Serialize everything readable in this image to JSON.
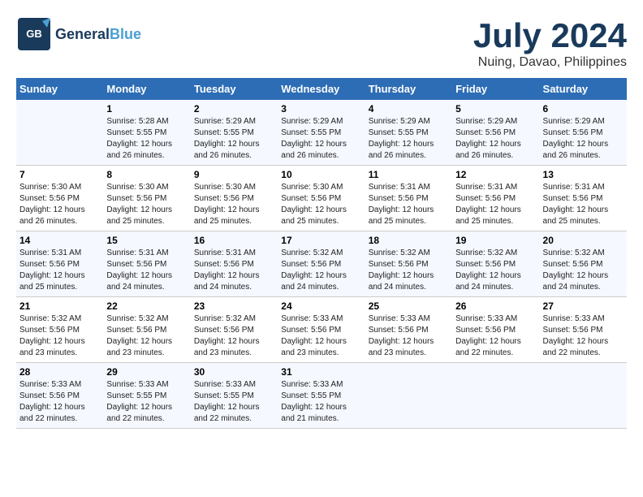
{
  "logo": {
    "text_general": "General",
    "text_blue": "Blue",
    "bird_symbol": "🐦"
  },
  "title": "July 2024",
  "subtitle": "Nuing, Davao, Philippines",
  "days_header": [
    "Sunday",
    "Monday",
    "Tuesday",
    "Wednesday",
    "Thursday",
    "Friday",
    "Saturday"
  ],
  "weeks": [
    [
      {
        "date": "",
        "info": ""
      },
      {
        "date": "1",
        "info": "Sunrise: 5:28 AM\nSunset: 5:55 PM\nDaylight: 12 hours\nand 26 minutes."
      },
      {
        "date": "2",
        "info": "Sunrise: 5:29 AM\nSunset: 5:55 PM\nDaylight: 12 hours\nand 26 minutes."
      },
      {
        "date": "3",
        "info": "Sunrise: 5:29 AM\nSunset: 5:55 PM\nDaylight: 12 hours\nand 26 minutes."
      },
      {
        "date": "4",
        "info": "Sunrise: 5:29 AM\nSunset: 5:55 PM\nDaylight: 12 hours\nand 26 minutes."
      },
      {
        "date": "5",
        "info": "Sunrise: 5:29 AM\nSunset: 5:56 PM\nDaylight: 12 hours\nand 26 minutes."
      },
      {
        "date": "6",
        "info": "Sunrise: 5:29 AM\nSunset: 5:56 PM\nDaylight: 12 hours\nand 26 minutes."
      }
    ],
    [
      {
        "date": "7",
        "info": "Sunrise: 5:30 AM\nSunset: 5:56 PM\nDaylight: 12 hours\nand 26 minutes."
      },
      {
        "date": "8",
        "info": "Sunrise: 5:30 AM\nSunset: 5:56 PM\nDaylight: 12 hours\nand 25 minutes."
      },
      {
        "date": "9",
        "info": "Sunrise: 5:30 AM\nSunset: 5:56 PM\nDaylight: 12 hours\nand 25 minutes."
      },
      {
        "date": "10",
        "info": "Sunrise: 5:30 AM\nSunset: 5:56 PM\nDaylight: 12 hours\nand 25 minutes."
      },
      {
        "date": "11",
        "info": "Sunrise: 5:31 AM\nSunset: 5:56 PM\nDaylight: 12 hours\nand 25 minutes."
      },
      {
        "date": "12",
        "info": "Sunrise: 5:31 AM\nSunset: 5:56 PM\nDaylight: 12 hours\nand 25 minutes."
      },
      {
        "date": "13",
        "info": "Sunrise: 5:31 AM\nSunset: 5:56 PM\nDaylight: 12 hours\nand 25 minutes."
      }
    ],
    [
      {
        "date": "14",
        "info": "Sunrise: 5:31 AM\nSunset: 5:56 PM\nDaylight: 12 hours\nand 25 minutes."
      },
      {
        "date": "15",
        "info": "Sunrise: 5:31 AM\nSunset: 5:56 PM\nDaylight: 12 hours\nand 24 minutes."
      },
      {
        "date": "16",
        "info": "Sunrise: 5:31 AM\nSunset: 5:56 PM\nDaylight: 12 hours\nand 24 minutes."
      },
      {
        "date": "17",
        "info": "Sunrise: 5:32 AM\nSunset: 5:56 PM\nDaylight: 12 hours\nand 24 minutes."
      },
      {
        "date": "18",
        "info": "Sunrise: 5:32 AM\nSunset: 5:56 PM\nDaylight: 12 hours\nand 24 minutes."
      },
      {
        "date": "19",
        "info": "Sunrise: 5:32 AM\nSunset: 5:56 PM\nDaylight: 12 hours\nand 24 minutes."
      },
      {
        "date": "20",
        "info": "Sunrise: 5:32 AM\nSunset: 5:56 PM\nDaylight: 12 hours\nand 24 minutes."
      }
    ],
    [
      {
        "date": "21",
        "info": "Sunrise: 5:32 AM\nSunset: 5:56 PM\nDaylight: 12 hours\nand 23 minutes."
      },
      {
        "date": "22",
        "info": "Sunrise: 5:32 AM\nSunset: 5:56 PM\nDaylight: 12 hours\nand 23 minutes."
      },
      {
        "date": "23",
        "info": "Sunrise: 5:32 AM\nSunset: 5:56 PM\nDaylight: 12 hours\nand 23 minutes."
      },
      {
        "date": "24",
        "info": "Sunrise: 5:33 AM\nSunset: 5:56 PM\nDaylight: 12 hours\nand 23 minutes."
      },
      {
        "date": "25",
        "info": "Sunrise: 5:33 AM\nSunset: 5:56 PM\nDaylight: 12 hours\nand 23 minutes."
      },
      {
        "date": "26",
        "info": "Sunrise: 5:33 AM\nSunset: 5:56 PM\nDaylight: 12 hours\nand 22 minutes."
      },
      {
        "date": "27",
        "info": "Sunrise: 5:33 AM\nSunset: 5:56 PM\nDaylight: 12 hours\nand 22 minutes."
      }
    ],
    [
      {
        "date": "28",
        "info": "Sunrise: 5:33 AM\nSunset: 5:56 PM\nDaylight: 12 hours\nand 22 minutes."
      },
      {
        "date": "29",
        "info": "Sunrise: 5:33 AM\nSunset: 5:55 PM\nDaylight: 12 hours\nand 22 minutes."
      },
      {
        "date": "30",
        "info": "Sunrise: 5:33 AM\nSunset: 5:55 PM\nDaylight: 12 hours\nand 22 minutes."
      },
      {
        "date": "31",
        "info": "Sunrise: 5:33 AM\nSunset: 5:55 PM\nDaylight: 12 hours\nand 21 minutes."
      },
      {
        "date": "",
        "info": ""
      },
      {
        "date": "",
        "info": ""
      },
      {
        "date": "",
        "info": ""
      }
    ]
  ]
}
